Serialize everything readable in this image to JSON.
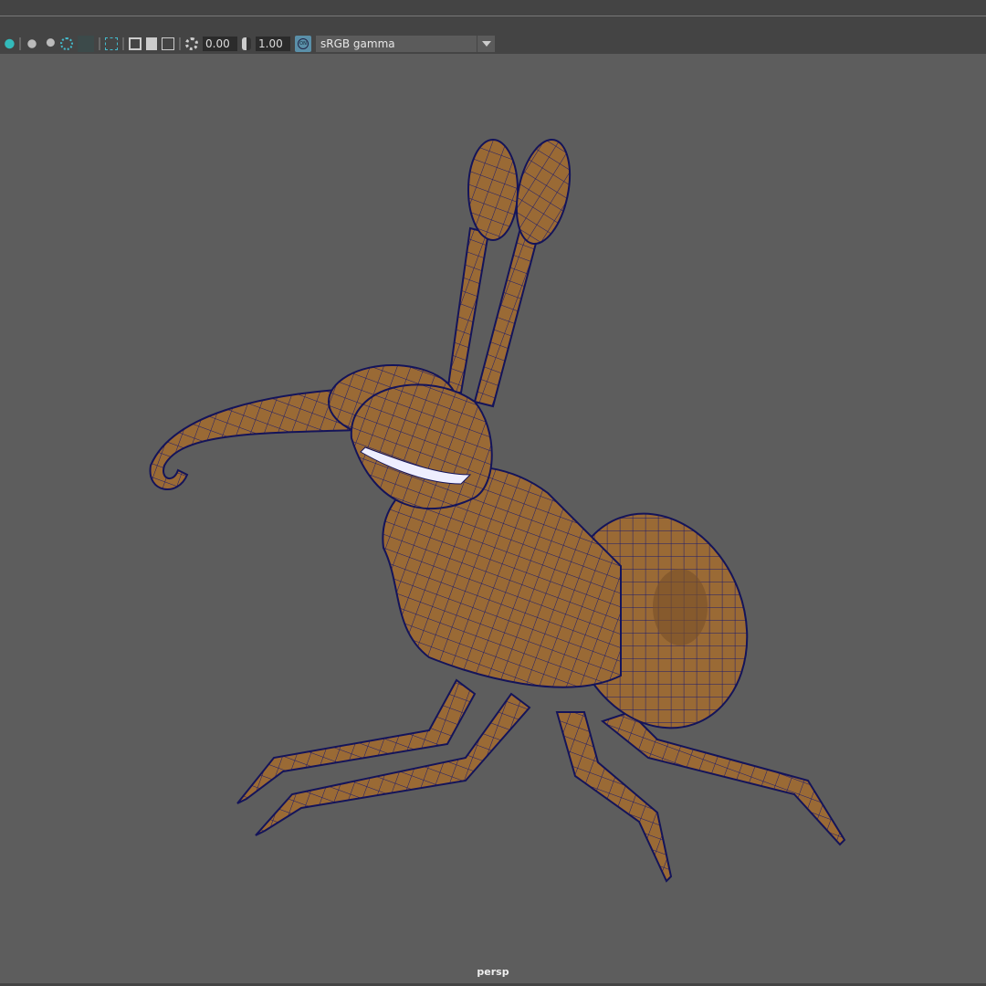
{
  "toolbar": {
    "icons": [
      "shading-icon",
      "lighting-icon",
      "shadow-icon",
      "ao-icon",
      "isolate-icon",
      "select-camera-icon",
      "resolution-gate-icon",
      "film-gate-icon",
      "safe-frame-icon",
      "exposure-icon",
      "gamma-icon",
      "color-management-icon"
    ],
    "exposure": "0.00",
    "gamma": "1.00",
    "cm_on": "ON",
    "color_space": "sRGB gamma"
  },
  "viewport": {
    "camera": "persp",
    "background": "#5d5d5d",
    "model_color": "#9a6a35",
    "wire_color": "#1a1a6e"
  }
}
